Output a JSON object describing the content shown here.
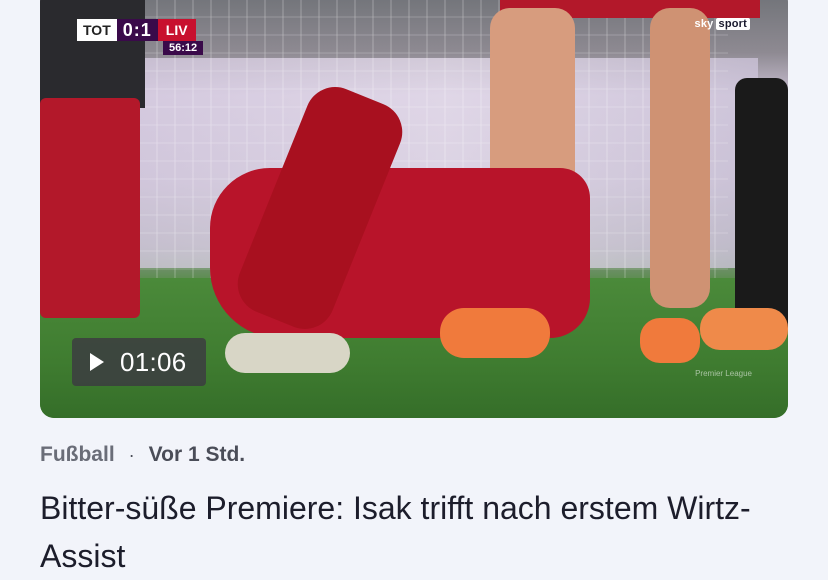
{
  "video": {
    "duration": "01:06",
    "scoreboard": {
      "home": "TOT",
      "score": "0:1",
      "away": "LIV",
      "clock": "56:12"
    },
    "broadcaster": {
      "name": "sky",
      "tag": "sport"
    },
    "watermark": "Premier League",
    "colors": {
      "home": "#ffffff",
      "away": "#c8102e",
      "score_bg": "#3a0a4a"
    }
  },
  "article": {
    "category": "Fußball",
    "separator": "·",
    "published": "Vor 1 Std.",
    "headline": "Bitter-süße Premiere: Isak trifft nach erstem Wirtz-Assist"
  }
}
